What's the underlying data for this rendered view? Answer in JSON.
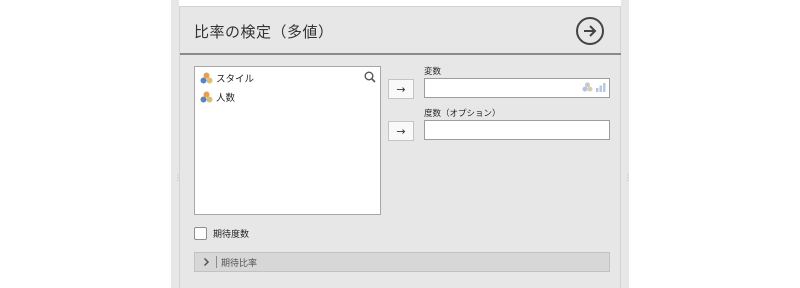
{
  "analysis": {
    "title": "比率の検定（多値）",
    "run_icon": "arrow-circle-right-icon"
  },
  "variables": {
    "items": [
      {
        "name": "スタイル",
        "icon": "nominal-variable-icon"
      },
      {
        "name": "人数",
        "icon": "nominal-variable-icon"
      }
    ],
    "search_icon": "search-icon"
  },
  "targets": {
    "variable_label": "変数",
    "variable_value": "",
    "count_label": "度数（オプション）",
    "count_value": "",
    "move_arrow": "→"
  },
  "options": {
    "expected_counts_label": "期待度数",
    "expected_counts_checked": false
  },
  "sections": {
    "expected_proportions_label": "期待比率",
    "expanded": false
  },
  "colors": {
    "panel_bg": "#e7e7e7",
    "accent_icon_blue": "#5a84c6",
    "accent_icon_orange": "#e8a14a"
  }
}
